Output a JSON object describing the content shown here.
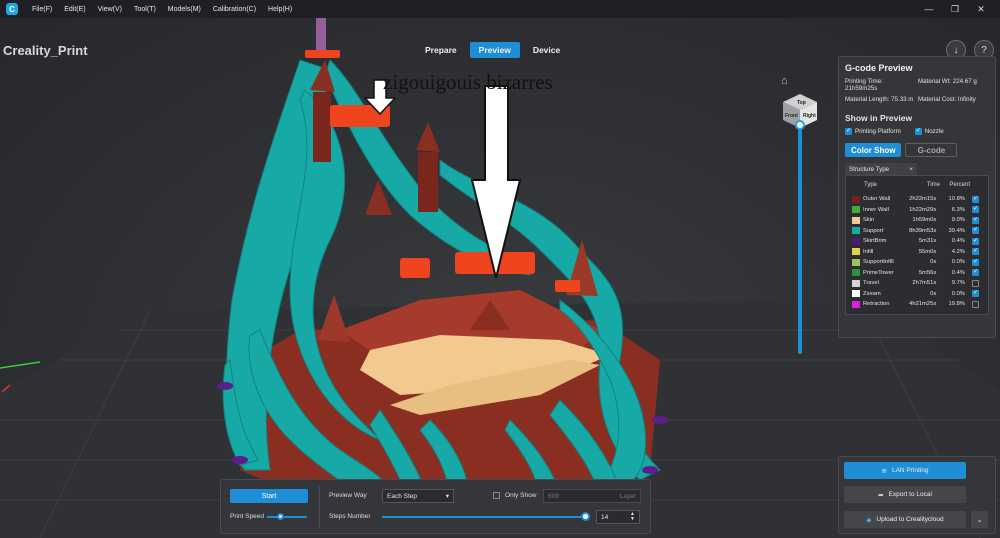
{
  "menu": {
    "items": [
      "File(F)",
      "Edit(E)",
      "View(V)",
      "Tool(T)",
      "Models(M)",
      "Calibration(C)",
      "Help(H)"
    ]
  },
  "window_controls": {
    "minimize": "—",
    "maximize": "❐",
    "close": "✕"
  },
  "app": {
    "brand": "Creality_Print",
    "logo_letter": "C"
  },
  "tabs": {
    "prepare": "Prepare",
    "preview": "Preview",
    "device": "Device"
  },
  "annotation": {
    "text": "zigouigouis bizarres"
  },
  "view_cube": {
    "top": "Top",
    "front": "Front",
    "right": "Right"
  },
  "gcode_panel": {
    "title": "G-code Preview",
    "printing_time": "Printing Time: 21h59m25s",
    "material_wt": "Material Wt: 224.67 g",
    "material_length": "Material Length: 75.33 m",
    "material_cost": "Material Cost: Infinity",
    "show_title": "Show in Preview",
    "printing_platform": "Printing Platform",
    "nozzle": "Nozzle",
    "color_show": "Color Show",
    "gcode": "G-code",
    "structure_tab": "Structure Type",
    "head_type": "Type",
    "head_time": "Time",
    "head_percent": "Percent",
    "rows": [
      {
        "name": "Outer Wall",
        "time": "2h22m15s",
        "percent": "10.8%",
        "color": "#7a1f1f",
        "checked": true
      },
      {
        "name": "Inner Wall",
        "time": "1h22m29s",
        "percent": "6.3%",
        "color": "#3fae3f",
        "checked": true
      },
      {
        "name": "Skin",
        "time": "1h59m0s",
        "percent": "9.0%",
        "color": "#f2c98e",
        "checked": true
      },
      {
        "name": "Support",
        "time": "8h39m53s",
        "percent": "39.4%",
        "color": "#17a9a6",
        "checked": true
      },
      {
        "name": "SkirtBrim",
        "time": "5m31s",
        "percent": "0.4%",
        "color": "#4a1d73",
        "checked": true
      },
      {
        "name": "Infill",
        "time": "55m0s",
        "percent": "4.2%",
        "color": "#e6d24a",
        "checked": true
      },
      {
        "name": "SupportInfill",
        "time": "0s",
        "percent": "0.0%",
        "color": "#9dc65a",
        "checked": true
      },
      {
        "name": "PrimeTower",
        "time": "5m56s",
        "percent": "0.4%",
        "color": "#2f8f3a",
        "checked": true
      },
      {
        "name": "Travel",
        "time": "2h7m51s",
        "percent": "9.7%",
        "color": "#d3d3d3",
        "checked": false
      },
      {
        "name": "Zseam",
        "time": "0s",
        "percent": "0.0%",
        "color": "#ffffff",
        "checked": true
      },
      {
        "name": "Retraction",
        "time": "4h21m25s",
        "percent": "19.8%",
        "color": "#e01ee0",
        "checked": false
      }
    ]
  },
  "actions": {
    "lan_printing": "LAN Printing",
    "export_local": "Export to Local",
    "upload": "Upload to Crealitycloud"
  },
  "controls": {
    "start": "Start",
    "print_speed": "Print Speed",
    "preview_way": "Preview Way",
    "preview_way_value": "Each Step",
    "only_show": "Only Show",
    "layer_value": "609",
    "layer_unit": "Layer",
    "steps_number": "Steps Number",
    "steps_value": "14"
  },
  "colors": {
    "accent": "#1e8ed6",
    "support": "#17a9a6",
    "wall": "#8b2e22",
    "skin": "#f2c98e",
    "overhang": "#f0441e"
  }
}
